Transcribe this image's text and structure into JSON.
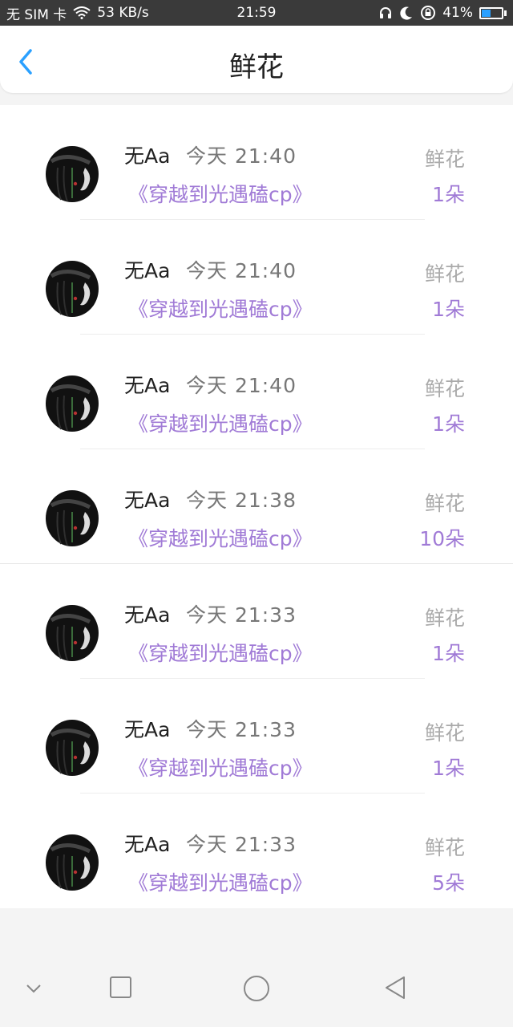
{
  "status_bar": {
    "sim": "无 SIM 卡",
    "speed": "53 KB/s",
    "time": "21:59",
    "battery": "41%",
    "battery_level": 0.41,
    "accent": "#2aa0ff"
  },
  "header": {
    "title": "鲜花",
    "back_icon": "chevron-left-icon",
    "accent": "#2aa0ff"
  },
  "records": [
    {
      "name": "无Aa",
      "time": "今天 21:40",
      "book": "《穿越到光遇磕cp》",
      "label": "鲜花",
      "count": "1朵"
    },
    {
      "name": "无Aa",
      "time": "今天 21:40",
      "book": "《穿越到光遇磕cp》",
      "label": "鲜花",
      "count": "1朵"
    },
    {
      "name": "无Aa",
      "time": "今天 21:40",
      "book": "《穿越到光遇磕cp》",
      "label": "鲜花",
      "count": "1朵"
    },
    {
      "name": "无Aa",
      "time": "今天 21:38",
      "book": "《穿越到光遇磕cp》",
      "label": "鲜花",
      "count": "10朵"
    },
    {
      "name": "无Aa",
      "time": "今天 21:33",
      "book": "《穿越到光遇磕cp》",
      "label": "鲜花",
      "count": "1朵"
    },
    {
      "name": "无Aa",
      "time": "今天 21:33",
      "book": "《穿越到光遇磕cp》",
      "label": "鲜花",
      "count": "1朵"
    },
    {
      "name": "无Aa",
      "time": "今天 21:33",
      "book": "《穿越到光遇磕cp》",
      "label": "鲜花",
      "count": "5朵"
    }
  ],
  "colors": {
    "purple": "#a07ad6",
    "gray_label": "#aaaaaa"
  },
  "nav_bar": {
    "icons": [
      "chevron-down-icon",
      "square-icon",
      "circle-icon",
      "triangle-back-icon"
    ]
  }
}
